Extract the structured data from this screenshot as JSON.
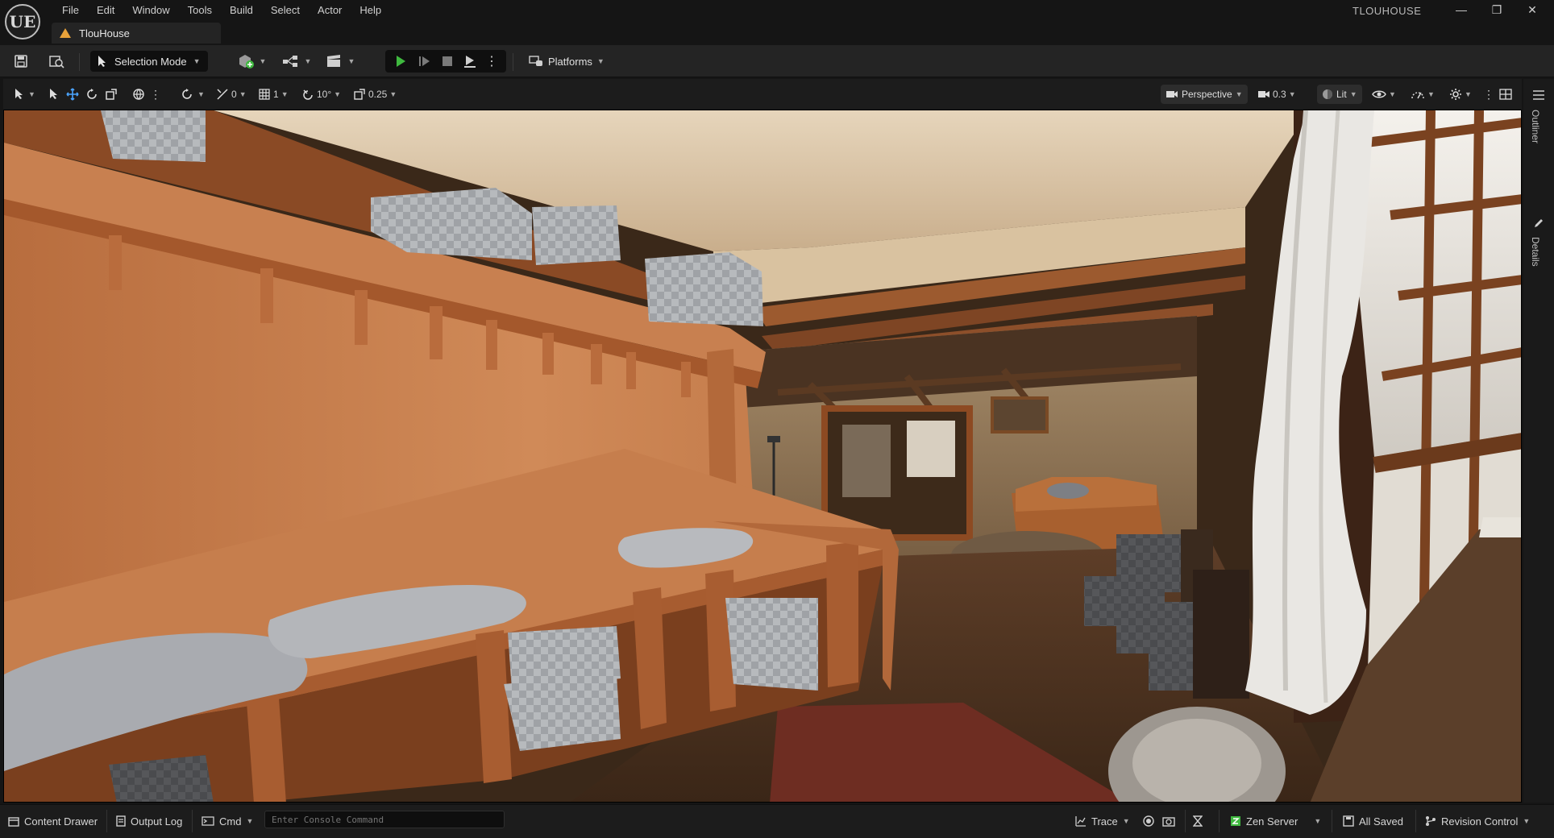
{
  "app": {
    "title": "TLOUHOUSE",
    "logo": "UE"
  },
  "menu": [
    "File",
    "Edit",
    "Window",
    "Tools",
    "Build",
    "Select",
    "Actor",
    "Help"
  ],
  "document_tab": {
    "label": "TlouHouse",
    "icon": "level-icon"
  },
  "toolbar": {
    "selection_mode": "Selection Mode",
    "platforms": "Platforms"
  },
  "viewport_toolbar": {
    "rotation_snap_value": "0",
    "grid_snap_value": "1",
    "angle_snap_value": "10°",
    "scale_snap_value": "0.25",
    "view_mode": "Perspective",
    "camera_speed": "0.3",
    "lighting_mode": "Lit"
  },
  "side_panel": {
    "outliner_label": "Outliner",
    "details_label": "Details"
  },
  "statusbar": {
    "content_drawer": "Content Drawer",
    "output_log": "Output Log",
    "cmd": "Cmd",
    "console_placeholder": "Enter Console Command",
    "trace": "Trace",
    "zen_server": "Zen Server",
    "all_saved": "All Saved",
    "revision_control": "Revision Control"
  },
  "colors": {
    "chrome_bg": "#151515",
    "toolbar_bg": "#242424",
    "play_green": "#3fb93f",
    "wall_orange": "#c97c4a",
    "wood_trim": "#8a4a25"
  }
}
